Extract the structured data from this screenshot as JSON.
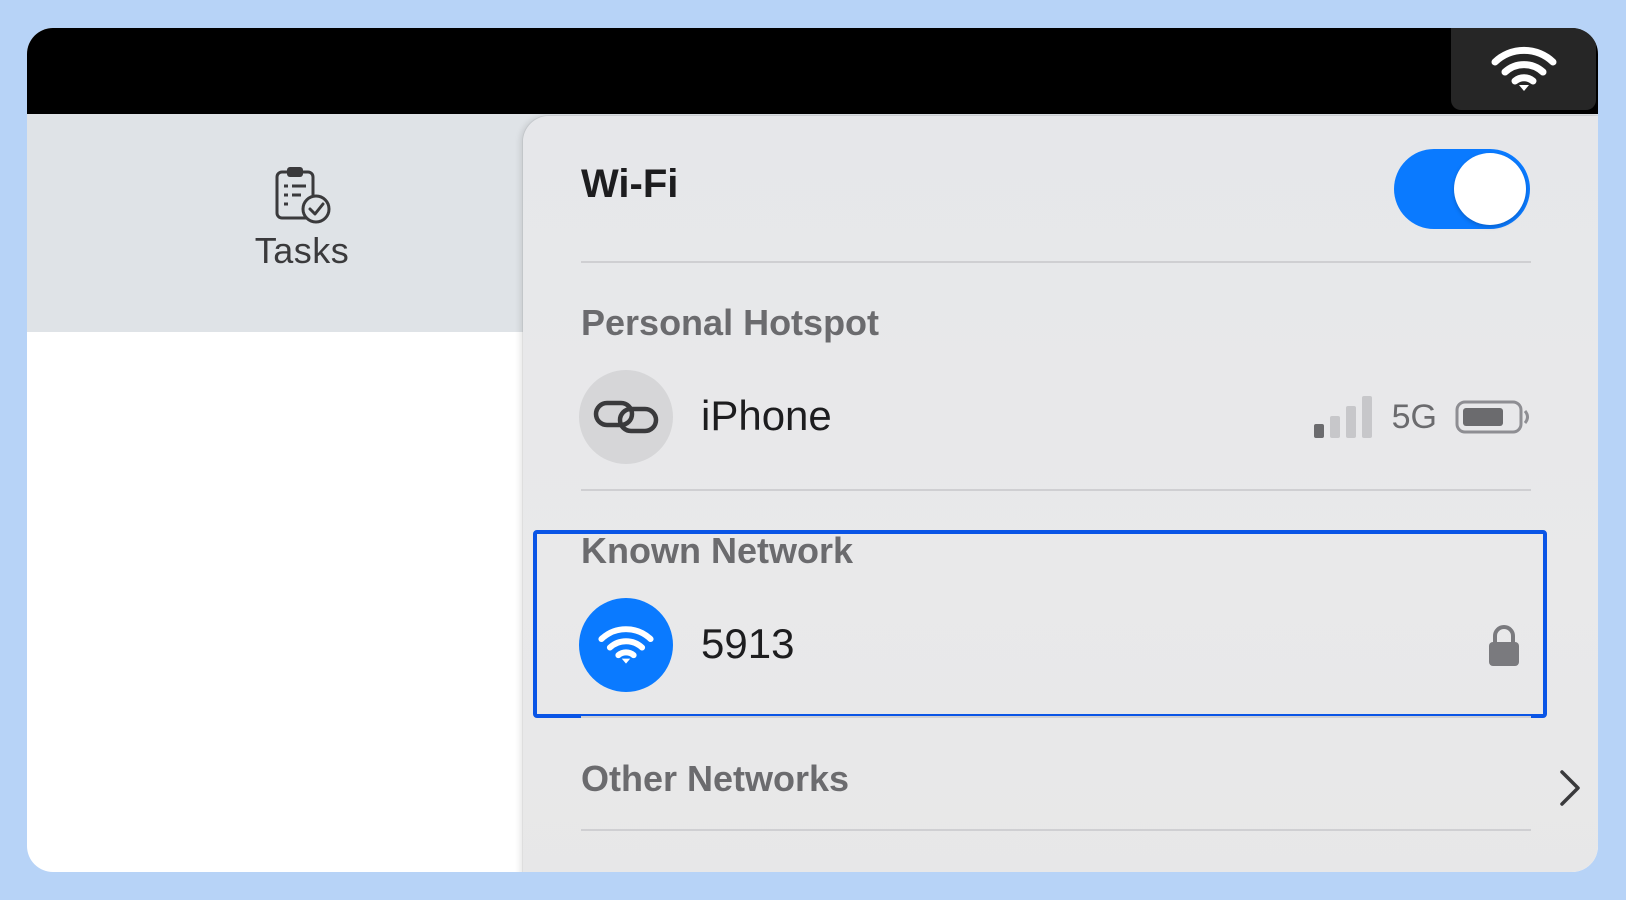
{
  "colors": {
    "frame": "#b7d3f7",
    "accent": "#0a7aff",
    "highlight": "#0a55e6"
  },
  "menubar": {
    "wifi_icon": "wifi-icon"
  },
  "toolbar": {
    "tasks": {
      "label": "Tasks",
      "icon": "clipboard-check-icon"
    }
  },
  "wifi_menu": {
    "title": "Wi-Fi",
    "toggle_on": true,
    "personal_hotspot": {
      "heading": "Personal Hotspot",
      "network": {
        "name": "iPhone",
        "signal_bars": 1,
        "network_type": "5G",
        "icon": "link-icon"
      }
    },
    "known_network": {
      "heading": "Known Network",
      "network": {
        "name": "5913",
        "icon": "wifi-icon",
        "secured": true
      }
    },
    "other_networks": {
      "label": "Other Networks",
      "icon": "chevron-right-icon"
    }
  }
}
